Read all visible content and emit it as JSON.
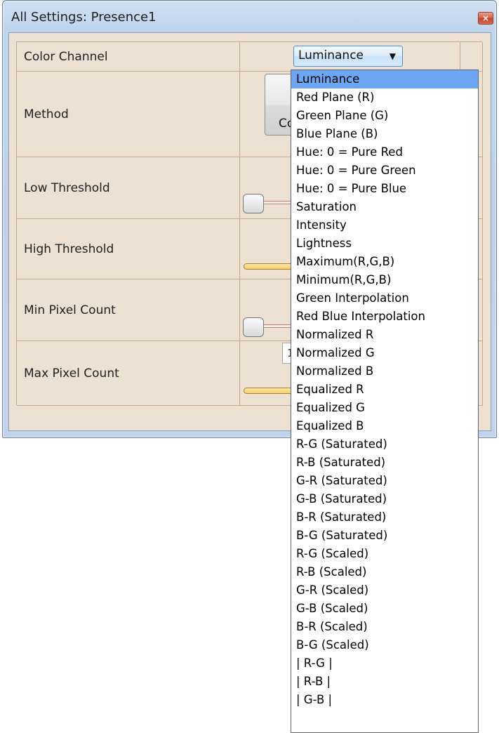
{
  "window": {
    "title": "All Settings: Presence1",
    "close_glyph": "×"
  },
  "rows": {
    "color_channel": {
      "label": "Color Channel",
      "value": "Luminance",
      "arrow": "▼"
    },
    "method": {
      "label": "Method",
      "button_text": "Co"
    },
    "low_threshold": {
      "label": "Low Threshold",
      "slider_level": 0.0
    },
    "high_threshold": {
      "label": "High Threshold"
    },
    "min_pixel_count": {
      "label": "Min Pixel Count",
      "slider_level": 0.0
    },
    "max_pixel_count": {
      "label": "Max Pixel Count",
      "value_fragment": "1"
    }
  },
  "dropdown": {
    "selected_index": 0,
    "options": [
      "Luminance",
      "Red  Plane  (R)",
      "Green Plane  (G)",
      "Blue  Plane  (B)",
      "Hue: 0 = Pure Red",
      "Hue: 0 = Pure Green",
      "Hue: 0 = Pure Blue",
      "Saturation",
      "Intensity",
      "Lightness",
      "Maximum(R,G,B)",
      "Minimum(R,G,B)",
      "Green Interpolation",
      "Red Blue Interpolation",
      "Normalized R",
      "Normalized G",
      "Normalized B",
      "Equalized R",
      "Equalized G",
      "Equalized B",
      "R-G (Saturated)",
      "R-B (Saturated)",
      "G-R (Saturated)",
      "G-B (Saturated)",
      "B-R (Saturated)",
      "B-G (Saturated)",
      "R-G (Scaled)",
      "R-B (Scaled)",
      "G-R (Scaled)",
      "G-B (Scaled)",
      "B-R (Scaled)",
      "B-G (Scaled)",
      "| R-G |",
      "| R-B |",
      "| G-B |"
    ]
  },
  "colors": {
    "selection_highlight": "#6da6f3",
    "grid_background": "#ece1d3",
    "slider_fill": "#f3cf6e"
  }
}
